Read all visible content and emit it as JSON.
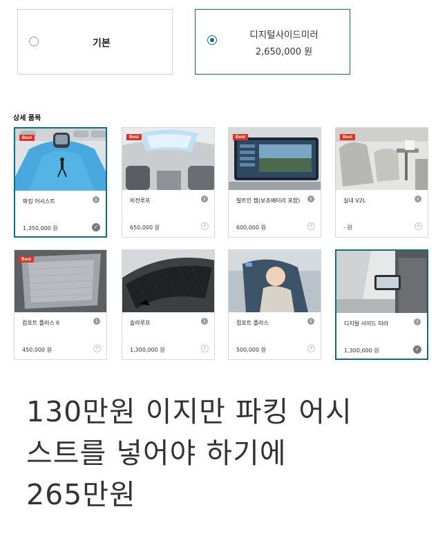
{
  "options": [
    {
      "label": "기본",
      "price": "",
      "selected": false
    },
    {
      "label": "디지털사이드미러",
      "price": "2,650,000 원",
      "selected": true
    }
  ],
  "section_title": "상세 품목",
  "badge_text": "Best",
  "items": [
    {
      "name": "파킹 어시스트",
      "price": "1,350,000 원",
      "best": true,
      "selected": true,
      "icon": "parking-assist-image"
    },
    {
      "name": "비전루프",
      "price": "650,000 원",
      "best": true,
      "selected": false,
      "icon": "vision-roof-image"
    },
    {
      "name": "빌트인 캠(보조배터리 포함)",
      "price": "600,000 원",
      "best": true,
      "selected": false,
      "icon": "builtin-cam-image"
    },
    {
      "name": "실내 V2L",
      "price": "- 원",
      "best": true,
      "selected": false,
      "icon": "v2l-image"
    },
    {
      "name": "컴포트 플러스 II",
      "price": "450,000 원",
      "best": true,
      "selected": false,
      "icon": "comfort-plus-2-image"
    },
    {
      "name": "솔라루프",
      "price": "1,300,000 원",
      "best": false,
      "selected": false,
      "icon": "solar-roof-image"
    },
    {
      "name": "컴포트 플러스",
      "price": "500,000 원",
      "best": false,
      "selected": false,
      "icon": "comfort-plus-image"
    },
    {
      "name": "디지털 사이드 미러",
      "price": "1,300,000 원",
      "best": false,
      "selected": true,
      "icon": "digital-side-mirror-image"
    }
  ],
  "caption_lines": [
    "130만원 이지만 파킹 어시",
    "스트를 넣어야 하기에",
    "265만원"
  ]
}
